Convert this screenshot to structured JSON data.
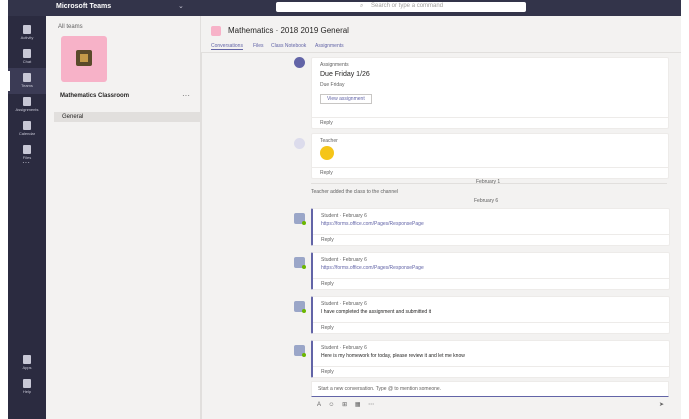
{
  "app": {
    "title": "Microsoft Teams"
  },
  "search": {
    "placeholder": "Search or type a command"
  },
  "rail": {
    "items": [
      {
        "label": "Activity"
      },
      {
        "label": "Chat"
      },
      {
        "label": "Teams"
      },
      {
        "label": "Assignments"
      },
      {
        "label": "Calendar"
      },
      {
        "label": "Files"
      }
    ],
    "bottom": [
      {
        "label": "Apps"
      },
      {
        "label": "Help"
      }
    ]
  },
  "panel": {
    "back": "All teams",
    "team_name": "Mathematics Classroom",
    "channel": "General"
  },
  "header": {
    "title": "Mathematics · 2018 2019 General",
    "tabs": [
      "Conversations",
      "Files",
      "Class Notebook",
      "Assignments"
    ]
  },
  "feed": {
    "assignment_card": {
      "author": "Assignments",
      "title": "Due Friday 1/26",
      "meta": "Due Friday",
      "button": "View assignment",
      "reply": "Reply"
    },
    "emoji_card": {
      "author": "Teacher",
      "reply": "Reply"
    },
    "date_divider": "February 1",
    "system_message": "Teacher added the class to the channel",
    "date_divider_2": "February 6",
    "posts": [
      {
        "author": "Student · February 6",
        "text": "https://forms.office.com/Pages/ResponsePage",
        "reply": "Reply"
      },
      {
        "author": "Student · February 6",
        "text": "https://forms.office.com/Pages/ResponsePage",
        "reply": "Reply"
      },
      {
        "author": "Student · February 6",
        "text": "I have completed the assignment and submitted it",
        "reply": "Reply"
      },
      {
        "author": "Student · February 6",
        "text": "Here is my homework for today, please review it and let me know",
        "reply": "Reply"
      }
    ]
  },
  "compose": {
    "placeholder": "Start a new conversation. Type @ to mention someone."
  },
  "toolbar": {
    "icons": "A ☺ ⊞ ▦ ⋯"
  },
  "colors": {
    "rail": "#2b2b40",
    "accent": "#6264a7",
    "topbar": "#33344a"
  }
}
